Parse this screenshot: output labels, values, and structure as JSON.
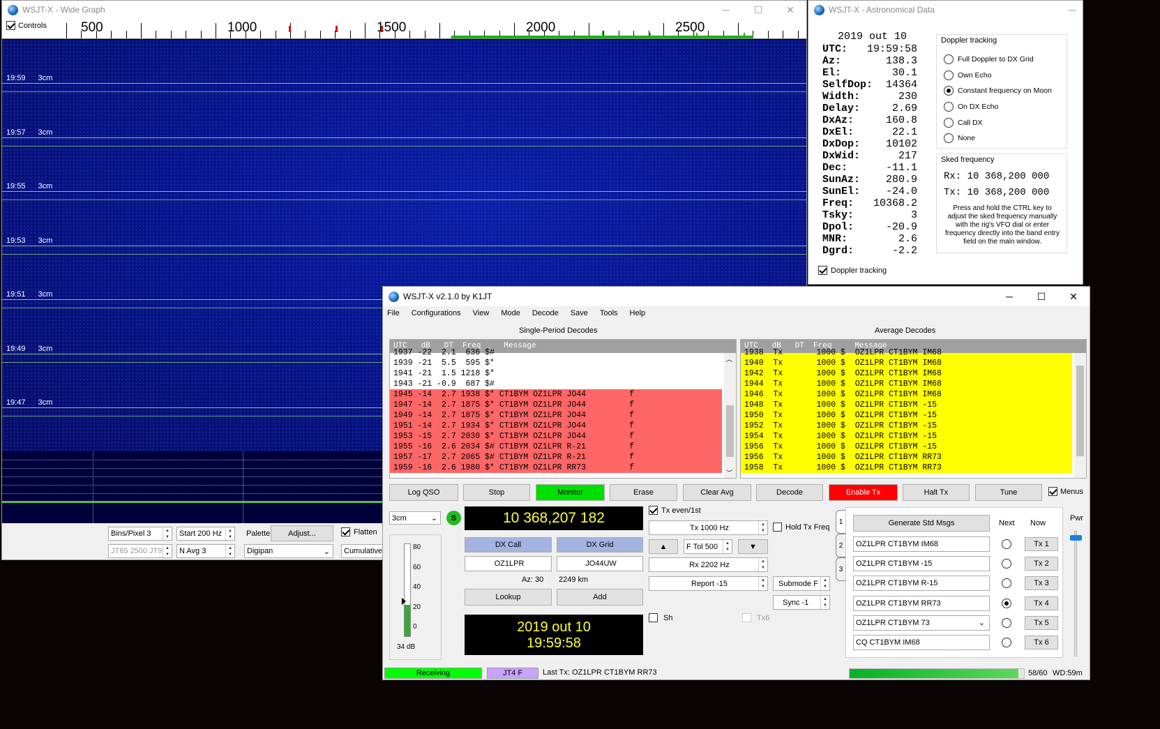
{
  "wide": {
    "title": "WSJT-X - Wide Graph",
    "controls_label": "Controls",
    "scale": [
      "500",
      "1000",
      "1500",
      "2000",
      "2500"
    ],
    "waterfall_labels": [
      {
        "time": "19:59",
        "band": "3cm"
      },
      {
        "time": "19:57",
        "band": "3cm"
      },
      {
        "time": "19:55",
        "band": "3cm"
      },
      {
        "time": "19:53",
        "band": "3cm"
      },
      {
        "time": "19:51",
        "band": "3cm"
      },
      {
        "time": "19:49",
        "band": "3cm"
      },
      {
        "time": "19:47",
        "band": "3cm"
      }
    ],
    "bins_label": "Bins/Pixel  3",
    "start_label": "Start 200 Hz",
    "palette_label": "Palette",
    "adjust_label": "Adjust...",
    "flatten_label": "Flatten",
    "jt65_label": "JT65  2500  JT9",
    "navg_label": "N Avg 3",
    "palette_value": "Digipan",
    "cumulative_label": "Cumulative"
  },
  "astro": {
    "title": "WSJT-X - Astronomical Data",
    "date": "2019 out 10",
    "rows": [
      {
        "k": "UTC:",
        "v": "19:59:58"
      },
      {
        "k": "Az:",
        "v": "138.3"
      },
      {
        "k": "El:",
        "v": "30.1"
      },
      {
        "k": "SelfDop:",
        "v": "14364"
      },
      {
        "k": "Width:",
        "v": "230"
      },
      {
        "k": "Delay:",
        "v": "2.69"
      },
      {
        "k": "DxAz:",
        "v": "160.8"
      },
      {
        "k": "DxEl:",
        "v": "22.1"
      },
      {
        "k": "DxDop:",
        "v": "10102"
      },
      {
        "k": "DxWid:",
        "v": "217"
      },
      {
        "k": "Dec:",
        "v": "-11.1"
      },
      {
        "k": "SunAz:",
        "v": "280.9"
      },
      {
        "k": "SunEl:",
        "v": "-24.0"
      },
      {
        "k": "Freq:",
        "v": "10368.2"
      },
      {
        "k": "Tsky:",
        "v": "3"
      },
      {
        "k": "Dpol:",
        "v": "-20.9"
      },
      {
        "k": "MNR:",
        "v": "2.6"
      },
      {
        "k": "Dgrd:",
        "v": "-2.2"
      }
    ],
    "doppler_group": "Doppler tracking",
    "doppler_options": [
      "Full Doppler to DX Grid",
      "Own Echo",
      "Constant frequency on Moon",
      "On DX Echo",
      "Call DX",
      "None"
    ],
    "doppler_selected": 2,
    "sked_group": "Sked frequency",
    "rx": "Rx: 10 368,200 000",
    "tx": "Tx: 10 368,200 000",
    "note": "Press and hold the CTRL key to adjust the sked frequency manually with the rig's VFO dial or enter frequency directly into the band entry field on the main window.",
    "doppler_check": "Doppler tracking"
  },
  "main": {
    "title": "WSJT-X   v2.1.0   by K1JT",
    "menu": [
      "File",
      "Configurations",
      "View",
      "Mode",
      "Decode",
      "Save",
      "Tools",
      "Help"
    ],
    "single_title": "Single-Period Decodes",
    "average_title": "Average Decodes",
    "single_header": "UTC   dB   DT  Freq     Message",
    "average_header": "UTC   dB   DT  Freq     Message",
    "single_rows": [
      {
        "t": "1937 -22  2.1  636 $#",
        "hl": false
      },
      {
        "t": "1939 -21  5.5  595 $*",
        "hl": false
      },
      {
        "t": "1941 -21  1.5 1218 $*",
        "hl": false
      },
      {
        "t": "1943 -21 -0.9  687 $#",
        "hl": false
      },
      {
        "t": "1945 -14  2.7 1938 $* CT1BYM OZ1LPR JO44         f",
        "hl": true
      },
      {
        "t": "1947 -14  2.7 1875 $* CT1BYM OZ1LPR JO44         f",
        "hl": true
      },
      {
        "t": "1949 -14  2.7 1875 $* CT1BYM OZ1LPR JO44         f",
        "hl": true
      },
      {
        "t": "1951 -14  2.7 1934 $* CT1BYM OZ1LPR JO44         f",
        "hl": true
      },
      {
        "t": "1953 -15  2.7 2030 $* CT1BYM OZ1LPR JO44         f",
        "hl": true
      },
      {
        "t": "1955 -16  2.6 2034 $# CT1BYM OZ1LPR R-21         f",
        "hl": true
      },
      {
        "t": "1957 -17  2.7 2065 $# CT1BYM OZ1LPR R-21         f",
        "hl": true
      },
      {
        "t": "1959 -16  2.6 1980 $* CT1BYM OZ1LPR RR73         f",
        "hl": true
      }
    ],
    "average_rows": [
      "1938  Tx       1000 $  OZ1LPR CT1BYM IM68",
      "1940  Tx       1000 $  OZ1LPR CT1BYM IM68",
      "1942  Tx       1000 $  OZ1LPR CT1BYM IM68",
      "1944  Tx       1000 $  OZ1LPR CT1BYM IM68",
      "1946  Tx       1000 $  OZ1LPR CT1BYM IM68",
      "1948  Tx       1000 $  OZ1LPR CT1BYM -15",
      "1950  Tx       1000 $  OZ1LPR CT1BYM -15",
      "1952  Tx       1000 $  OZ1LPR CT1BYM -15",
      "1954  Tx       1000 $  OZ1LPR CT1BYM -15",
      "1956  Tx       1000 $  OZ1LPR CT1BYM -15",
      "1956  Tx       1000 $  OZ1LPR CT1BYM RR73",
      "1958  Tx       1000 $  OZ1LPR CT1BYM RR73"
    ],
    "buttons": {
      "log": "Log QSO",
      "stop": "Stop",
      "monitor": "Monitor",
      "erase": "Erase",
      "clear_avg": "Clear Avg",
      "decode": "Decode",
      "enable_tx": "Enable Tx",
      "halt_tx": "Halt Tx",
      "tune": "Tune",
      "menus": "Menus"
    },
    "band": "3cm",
    "s_badge": "S",
    "frequency": "10 368,207 182",
    "tx_even": "Tx even/1st",
    "tx_freq": "Tx  1000  Hz",
    "hold_tx": "Hold Tx Freq",
    "ftol": "F Tol  500",
    "rx_freq": "Rx  2202  Hz",
    "report": "Report -15",
    "submode": "Submode F",
    "sync": "Sync  -1",
    "sh": "Sh",
    "tx6": "Tx6",
    "dx_call_label": "DX Call",
    "dx_grid_label": "DX Grid",
    "dx_call": "OZ1LPR",
    "dx_grid": "JO44UW",
    "az": "Az: 30",
    "dist": "2249 km",
    "lookup": "Lookup",
    "add": "Add",
    "date": "2019 out 10",
    "time": "19:59:58",
    "meter_ticks": [
      "80",
      "60",
      "40",
      "20",
      "0"
    ],
    "meter_db": "34 dB",
    "meter_level": 0.34,
    "tabs": [
      "1",
      "2",
      "3"
    ],
    "gen_std": "Generate Std Msgs",
    "next": "Next",
    "now": "Now",
    "pwr": "Pwr",
    "msgs": [
      {
        "text": "OZ1LPR CT1BYM IM68",
        "tx": "Tx 1"
      },
      {
        "text": "OZ1LPR CT1BYM -15",
        "tx": "Tx 2"
      },
      {
        "text": "OZ1LPR CT1BYM R-15",
        "tx": "Tx 3"
      },
      {
        "text": "OZ1LPR CT1BYM RR73",
        "tx": "Tx 4"
      },
      {
        "text": "OZ1LPR CT1BYM 73",
        "tx": "Tx 5"
      },
      {
        "text": "CQ CT1BYM IM68",
        "tx": "Tx 6"
      }
    ],
    "next_selected": 3,
    "status_receiving": "Receiving",
    "status_mode": "JT4 F",
    "status_last": "Last Tx: OZ1LPR CT1BYM RR73",
    "progress_label": "58/60",
    "progress": 0.967,
    "wd": "WD:59m"
  }
}
